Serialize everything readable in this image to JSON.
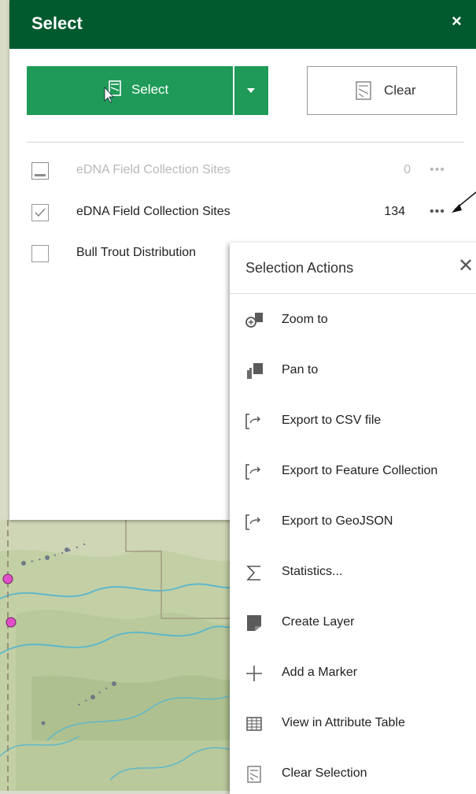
{
  "panel": {
    "title": "Select",
    "close_glyph": "×",
    "select_button": "Select",
    "clear_button": "Clear"
  },
  "layers": [
    {
      "name": "eDNA Field Collection Sites",
      "count": "0",
      "checked": false,
      "disabled": true,
      "menu": "•••"
    },
    {
      "name": "eDNA Field Collection Sites",
      "count": "134",
      "checked": true,
      "disabled": false,
      "menu": "•••"
    },
    {
      "name": "Bull Trout Distribution",
      "count": "",
      "checked": false,
      "disabled": false,
      "menu": ""
    }
  ],
  "popup": {
    "title": "Selection Actions",
    "close_glyph": "✕",
    "actions": [
      {
        "label": "Zoom to",
        "icon": "zoom-to-icon"
      },
      {
        "label": "Pan to",
        "icon": "pan-to-icon"
      },
      {
        "label": "Export to CSV file",
        "icon": "export-icon"
      },
      {
        "label": "Export to Feature Collection",
        "icon": "export-icon"
      },
      {
        "label": "Export to GeoJSON",
        "icon": "export-icon"
      },
      {
        "label": "Statistics...",
        "icon": "sigma-icon"
      },
      {
        "label": "Create Layer",
        "icon": "layer-icon"
      },
      {
        "label": "Add a Marker",
        "icon": "plus-icon"
      },
      {
        "label": "View in Attribute Table",
        "icon": "table-icon"
      },
      {
        "label": "Clear Selection",
        "icon": "clear-selection-icon"
      }
    ]
  },
  "colors": {
    "header": "#005a2e",
    "select_button": "#1f9a58",
    "map_green": "#bfd0a6",
    "river": "#5fb7c9"
  }
}
